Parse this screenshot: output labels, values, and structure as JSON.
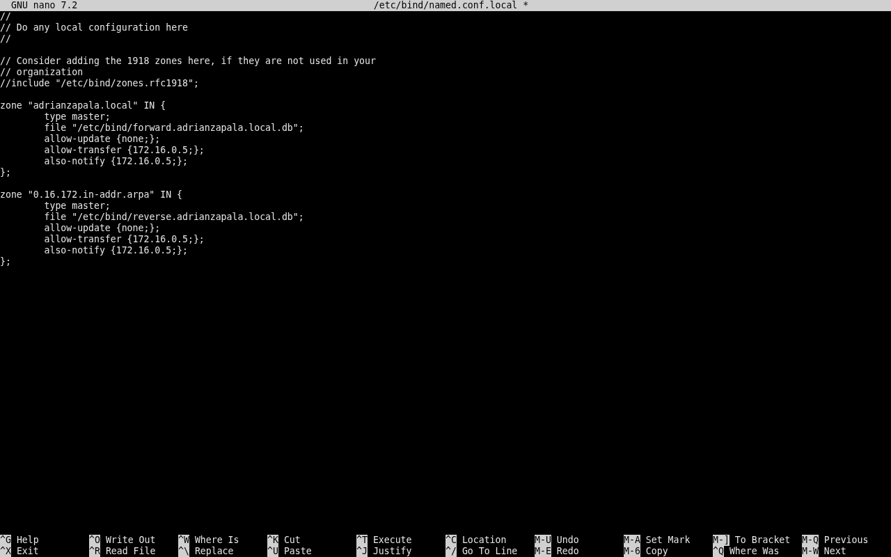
{
  "title_bar": {
    "app": "GNU nano 7.2",
    "file": "/etc/bind/named.conf.local *"
  },
  "editor": {
    "blocks": [
      [
        "//",
        "// Do any local configuration here",
        "//"
      ],
      [
        "// Consider adding the 1918 zones here, if they are not used in your",
        "// organization",
        "//include \"/etc/bind/zones.rfc1918\";"
      ],
      [
        "zone \"adrianzapala.local\" IN {",
        "\ttype master;",
        "\tfile \"/etc/bind/forward.adrianzapala.local.db\";",
        "\tallow-update {none;};",
        "\tallow-transfer {172.16.0.5;};",
        "\talso-notify {172.16.0.5;};",
        "};"
      ],
      [
        "zone \"0.16.172.in-addr.arpa\" IN {",
        "\ttype master;",
        "\tfile \"/etc/bind/reverse.adrianzapala.local.db\";",
        "\tallow-update {none;};",
        "\tallow-transfer {172.16.0.5;};",
        "\talso-notify {172.16.0.5;};",
        "};"
      ]
    ]
  },
  "shortcuts": [
    [
      {
        "key": "^G",
        "label": "Help"
      },
      {
        "key": "^O",
        "label": "Write Out"
      },
      {
        "key": "^W",
        "label": "Where Is"
      },
      {
        "key": "^K",
        "label": "Cut"
      },
      {
        "key": "^T",
        "label": "Execute"
      },
      {
        "key": "^C",
        "label": "Location"
      },
      {
        "key": "M-U",
        "label": "Undo"
      },
      {
        "key": "M-A",
        "label": "Set Mark"
      },
      {
        "key": "M-]",
        "label": "To Bracket"
      },
      {
        "key": "M-Q",
        "label": "Previous"
      }
    ],
    [
      {
        "key": "^X",
        "label": "Exit"
      },
      {
        "key": "^R",
        "label": "Read File"
      },
      {
        "key": "^\\",
        "label": "Replace"
      },
      {
        "key": "^U",
        "label": "Paste"
      },
      {
        "key": "^J",
        "label": "Justify"
      },
      {
        "key": "^/",
        "label": "Go To Line"
      },
      {
        "key": "M-E",
        "label": "Redo"
      },
      {
        "key": "M-6",
        "label": "Copy"
      },
      {
        "key": "^Q",
        "label": "Where Was"
      },
      {
        "key": "M-W",
        "label": "Next"
      }
    ]
  ]
}
